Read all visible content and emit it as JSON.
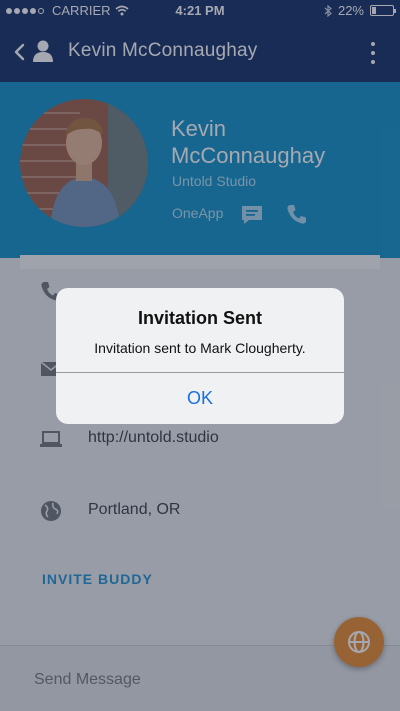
{
  "status_bar": {
    "carrier": "CARRIER",
    "time": "4:21 PM",
    "battery": "22%",
    "battery_level": 0.22
  },
  "nav": {
    "title": "Kevin McConnaughay"
  },
  "profile": {
    "name": "Kevin McConnaughay",
    "company": "Untold Studio",
    "app": "OneApp"
  },
  "contact_rows": [
    {
      "icon": "phone-icon",
      "text": ""
    },
    {
      "icon": "email-icon",
      "text": ""
    },
    {
      "icon": "laptop-icon",
      "text": "http://untold.studio"
    },
    {
      "icon": "globe-icon",
      "text": "Portland, OR"
    }
  ],
  "invite_label": "INVITE BUDDY",
  "message": {
    "placeholder": "Send Message"
  },
  "alert": {
    "title": "Invitation Sent",
    "message": "Invitation sent to Mark Clougherty.",
    "ok_label": "OK"
  },
  "colors": {
    "nav_bg": "#0f2a63",
    "header_bg": "#0a8ec8",
    "accent_link": "#1c8fd1",
    "fab_bg": "#e8892a",
    "alert_button": "#1a6fe0"
  }
}
